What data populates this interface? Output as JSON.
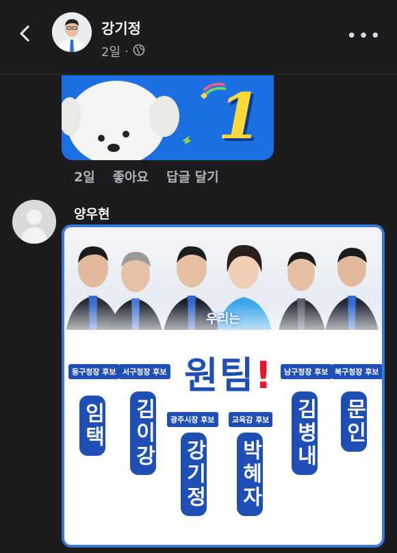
{
  "header": {
    "author": "강기정",
    "time": "2일",
    "privacy_icon": "globe-icon",
    "separator": "·"
  },
  "first_comment": {
    "sticker": "puppy-sticker",
    "sticker_number": "1",
    "actions": {
      "time": "2일",
      "like": "좋아요",
      "reply": "답글 달기"
    }
  },
  "second_comment": {
    "author": "양우현",
    "poster": {
      "slogan": "우리는",
      "team_text": "원팀",
      "exclamation": "!",
      "candidates": [
        {
          "tag": "동구청장 후보",
          "name": "임택"
        },
        {
          "tag": "서구청장 후보",
          "name": "김이강"
        },
        {
          "tag": "광주시장 후보",
          "name": "강기정"
        },
        {
          "tag": "교육감 후보",
          "name": "박혜자"
        },
        {
          "tag": "남구청장 후보",
          "name": "김병내"
        },
        {
          "tag": "북구청장 후보",
          "name": "문인"
        }
      ]
    }
  },
  "colors": {
    "background": "#1c1c1e",
    "accent_blue": "#1f4fb4",
    "sticker_blue": "#1b6fe3",
    "accent_red": "#e4172d"
  }
}
